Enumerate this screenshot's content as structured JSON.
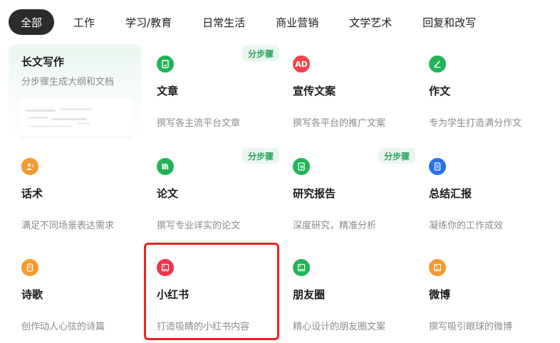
{
  "tabs": [
    {
      "label": "全部",
      "active": true
    },
    {
      "label": "工作"
    },
    {
      "label": "学习/教育"
    },
    {
      "label": "日常生活"
    },
    {
      "label": "商业营销"
    },
    {
      "label": "文学艺术"
    },
    {
      "label": "回复和改写"
    }
  ],
  "featured": {
    "title": "长文写作",
    "desc": "分步骤生成大纲和文档"
  },
  "cards": [
    {
      "title": "文章",
      "desc": "撰写各主流平台文章",
      "icon": "document-icon",
      "color": "#22b358",
      "badge": "分步骤"
    },
    {
      "title": "宣传文案",
      "desc": "撰写各平台的推广文案",
      "icon": "ad-icon",
      "icon_text": "AD",
      "color": "#f0434a"
    },
    {
      "title": "作文",
      "desc": "专为学生打造满分作文",
      "icon": "pen-icon",
      "color": "#22b358"
    },
    {
      "title": "话术",
      "desc": "满足不同场景表达需求",
      "icon": "speaker-icon",
      "color": "#f59a2c"
    },
    {
      "title": "论文",
      "desc": "撰写专业详实的论文",
      "icon": "books-icon",
      "color": "#22b358",
      "badge": "分步骤"
    },
    {
      "title": "研究报告",
      "desc": "深度研究，精准分析",
      "icon": "report-icon",
      "color": "#22b358",
      "badge": "分步骤"
    },
    {
      "title": "总结汇报",
      "desc": "凝练你的工作成效",
      "icon": "notebook-icon",
      "color": "#2a6ff0"
    },
    {
      "title": "诗歌",
      "desc": "创作动人心弦的诗篇",
      "icon": "scroll-icon",
      "color": "#f59a2c"
    },
    {
      "title": "小红书",
      "desc": "打造吸睛的小红书内容",
      "icon": "image-card-icon",
      "color": "#f0334a"
    },
    {
      "title": "朋友圈",
      "desc": "精心设计的朋友圈文案",
      "icon": "image-card-icon",
      "color": "#22b358"
    },
    {
      "title": "微博",
      "desc": "撰写吸引眼球的微博",
      "icon": "image-card-icon",
      "color": "#f59a2c"
    }
  ]
}
